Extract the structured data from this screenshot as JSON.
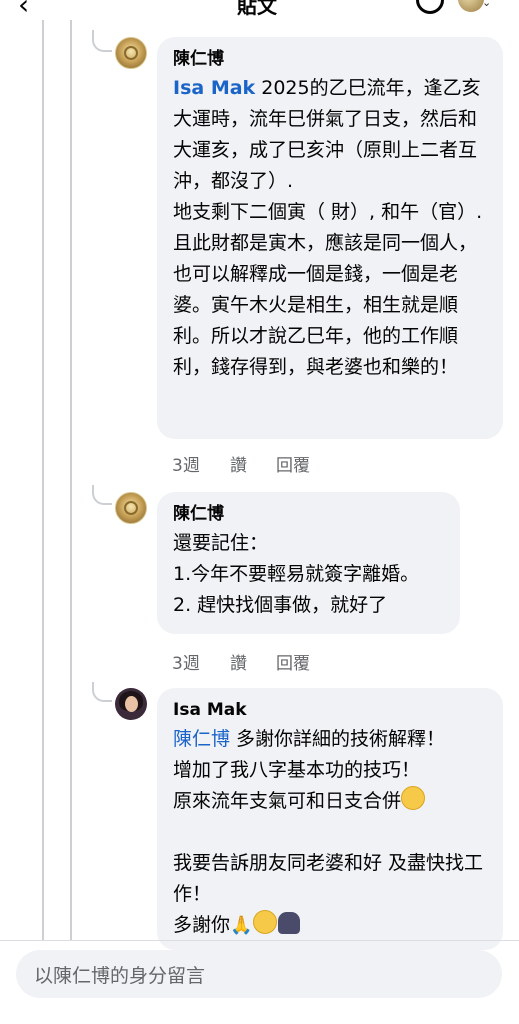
{
  "header": {
    "title": "貼文",
    "back": "‹"
  },
  "comments": [
    {
      "author": "陳仁博",
      "mention": "Isa Mak",
      "text_after_mention": " 2025的乙巳流年，逢乙亥大運時，流年巳併氣了日支，然后和大運亥，成了巳亥沖（原則上二者互沖，都沒了）.\n地支剩下二個寅（ 財）, 和午（官）. 且此財都是寅木，應該是同一個人，也可以解釋成一個是錢，一個是老婆。寅午木火是相生，相生就是順利。所以才說乙巳年，他的工作順利，錢存得到，與老婆也和樂的！",
      "time": "3週",
      "like": "讚",
      "reply": "回覆"
    },
    {
      "author": "陳仁博",
      "text": "還要記住：\n1.今年不要輕易就簽字離婚。\n2. 趕快找個事做，就好了",
      "time": "3週",
      "like": "讚",
      "reply": "回覆"
    },
    {
      "author": "Isa Mak",
      "mention": "陳仁博",
      "text_after_mention": " 多謝你詳細的技術解釋！\n增加了我八字基本功的技巧！\n原來流年支氣可和日支合併",
      "text_part2": "我要告訴朋友同老婆和好 及盡快找工作！\n多謝你"
    }
  ],
  "composer": {
    "placeholder": "以陳仁博的身分留言"
  },
  "colors": {
    "mention": "#1b64c8",
    "bubble": "#f0f2f5",
    "meta": "#65676b"
  },
  "icons": [
    "back-arrow-icon",
    "search-icon",
    "profile-avatar-icon",
    "chevron-down-icon"
  ]
}
